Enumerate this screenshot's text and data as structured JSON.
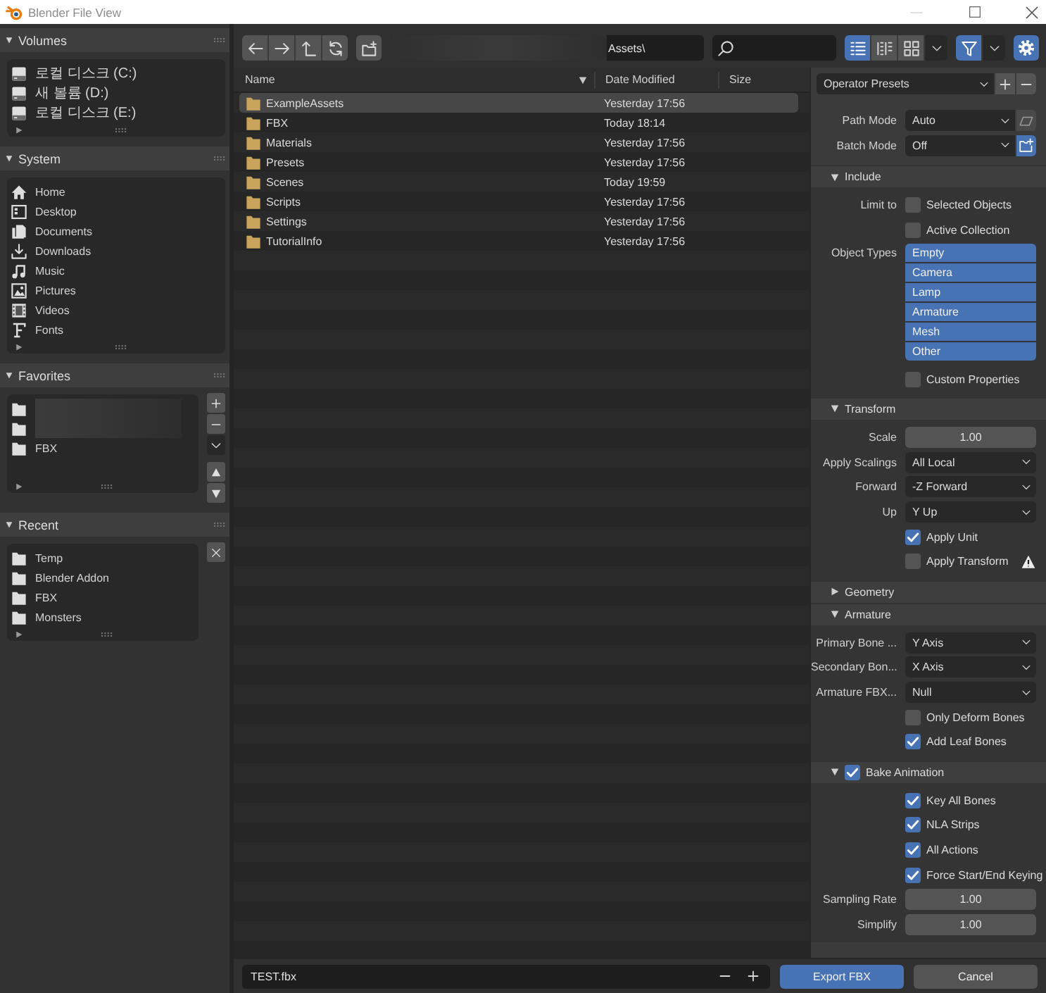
{
  "window": {
    "title": "Blender File View"
  },
  "sidebar": {
    "panels": [
      {
        "title": "Volumes",
        "expanded": true,
        "items": [
          {
            "kind": "drive",
            "label": "로컬 디스크 (C:)"
          },
          {
            "kind": "drive",
            "label": "새 볼륨 (D:)"
          },
          {
            "kind": "drive",
            "label": "로컬 디스크 (E:)"
          }
        ]
      },
      {
        "title": "System",
        "expanded": true,
        "items": [
          {
            "kind": "home",
            "label": "Home"
          },
          {
            "kind": "desktop",
            "label": "Desktop"
          },
          {
            "kind": "documents",
            "label": "Documents"
          },
          {
            "kind": "downloads",
            "label": "Downloads"
          },
          {
            "kind": "music",
            "label": "Music"
          },
          {
            "kind": "pictures",
            "label": "Pictures"
          },
          {
            "kind": "videos",
            "label": "Videos"
          },
          {
            "kind": "fonts",
            "label": "Fonts"
          }
        ]
      },
      {
        "title": "Favorites",
        "expanded": true,
        "items": [
          {
            "kind": "blurred"
          },
          {
            "kind": "blurred"
          },
          {
            "kind": "folder",
            "label": "FBX"
          }
        ],
        "side_buttons": [
          {
            "kind": "add"
          },
          {
            "kind": "remove"
          },
          {
            "kind": "menu"
          },
          {
            "kind": "move_up"
          },
          {
            "kind": "move_down"
          }
        ]
      },
      {
        "title": "Recent",
        "expanded": true,
        "items": [
          {
            "kind": "folder",
            "label": "Temp"
          },
          {
            "kind": "folder",
            "label": "Blender Addon"
          },
          {
            "kind": "folder",
            "label": "FBX"
          },
          {
            "kind": "folder",
            "label": "Monsters"
          }
        ],
        "side_buttons": [
          {
            "kind": "clear"
          }
        ]
      }
    ]
  },
  "toolbar": {
    "path": "Assets\\",
    "display_modes": [
      {
        "kind": "vertical_list",
        "selected": true
      },
      {
        "kind": "horizontal_list",
        "selected": false
      },
      {
        "kind": "thumbnails",
        "selected": false
      }
    ],
    "filter": {
      "on": true
    },
    "settings": {
      "on": true
    }
  },
  "files": {
    "columns": [
      {
        "label": "Name",
        "sorted": true
      },
      {
        "label": "Date Modified",
        "sorted": false
      },
      {
        "label": "Size",
        "sorted": false
      }
    ],
    "rows": [
      {
        "name": "ExampleAssets",
        "modified": "Yesterday 17:56",
        "selected": true
      },
      {
        "name": "FBX",
        "modified": "Today 18:14",
        "selected": false
      },
      {
        "name": "Materials",
        "modified": "Yesterday 17:56",
        "selected": false
      },
      {
        "name": "Presets",
        "modified": "Yesterday 17:56",
        "selected": false
      },
      {
        "name": "Scenes",
        "modified": "Today 19:59",
        "selected": false
      },
      {
        "name": "Scripts",
        "modified": "Yesterday 17:56",
        "selected": false
      },
      {
        "name": "Settings",
        "modified": "Yesterday 17:56",
        "selected": false
      },
      {
        "name": "TutorialInfo",
        "modified": "Yesterday 17:56",
        "selected": false
      }
    ]
  },
  "properties": {
    "presets": "Operator Presets",
    "rows": [
      {
        "kind": "dropdown",
        "label": "Path Mode",
        "value": "Auto",
        "toggle": {
          "kind": "embed",
          "on": false
        }
      },
      {
        "kind": "dropdown",
        "label": "Batch Mode",
        "value": "Off",
        "toggle": {
          "kind": "folder",
          "on": true
        }
      }
    ],
    "sections": [
      {
        "title": "Include",
        "expanded": true,
        "rows": [
          {
            "kind": "checkbox",
            "label": "Limit to",
            "text": "Selected Objects",
            "checked": false
          },
          {
            "kind": "checkbox",
            "text": "Active Collection",
            "checked": false
          },
          {
            "kind": "options",
            "label": "Object Types",
            "options": [
              {
                "label": "Empty",
                "selected": true
              },
              {
                "label": "Camera",
                "selected": true
              },
              {
                "label": "Lamp",
                "selected": true
              },
              {
                "label": "Armature",
                "selected": true
              },
              {
                "label": "Mesh",
                "selected": true
              },
              {
                "label": "Other",
                "selected": true
              }
            ]
          },
          {
            "kind": "checkbox",
            "text": "Custom Properties",
            "checked": false
          }
        ]
      },
      {
        "title": "Transform",
        "expanded": true,
        "rows": [
          {
            "kind": "number",
            "label": "Scale",
            "value": "1.00"
          },
          {
            "kind": "dropdown",
            "label": "Apply Scalings",
            "value": "All Local"
          },
          {
            "kind": "dropdown",
            "label": "Forward",
            "value": "-Z Forward"
          },
          {
            "kind": "dropdown",
            "label": "Up",
            "value": "Y Up"
          },
          {
            "kind": "checkbox",
            "text": "Apply Unit",
            "checked": true
          },
          {
            "kind": "checkbox",
            "text": "Apply Transform",
            "checked": false,
            "warning": true
          }
        ]
      },
      {
        "title": "Geometry",
        "expanded": false
      },
      {
        "title": "Armature",
        "expanded": true,
        "rows": [
          {
            "kind": "dropdown",
            "label": "Primary Bone ...",
            "value": "Y Axis"
          },
          {
            "kind": "dropdown",
            "label": "Secondary Bon...",
            "value": "X Axis"
          },
          {
            "kind": "dropdown",
            "label": "Armature FBX...",
            "value": "Null"
          },
          {
            "kind": "checkbox",
            "text": "Only Deform Bones",
            "checked": false
          },
          {
            "kind": "checkbox",
            "text": "Add Leaf Bones",
            "checked": true
          }
        ]
      },
      {
        "title": "Bake Animation",
        "expanded": true,
        "checked": true,
        "rows": [
          {
            "kind": "checkbox",
            "text": "Key All Bones",
            "checked": true
          },
          {
            "kind": "checkbox",
            "text": "NLA Strips",
            "checked": true
          },
          {
            "kind": "checkbox",
            "text": "All Actions",
            "checked": true
          },
          {
            "kind": "checkbox",
            "text": "Force Start/End Keying",
            "checked": true
          },
          {
            "kind": "number",
            "label": "Sampling Rate",
            "value": "1.00"
          },
          {
            "kind": "number",
            "label": "Simplify",
            "value": "1.00"
          }
        ]
      }
    ]
  },
  "footer": {
    "filename": "TEST.fbx",
    "buttons": [
      {
        "label": "Export FBX",
        "primary": true
      },
      {
        "label": "Cancel",
        "primary": false
      }
    ]
  }
}
